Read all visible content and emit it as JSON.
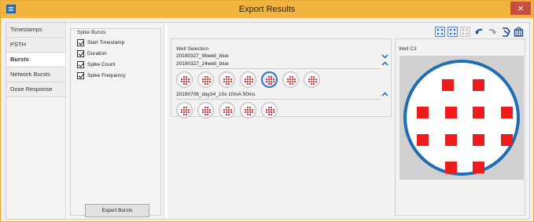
{
  "window": {
    "title": "Export Results",
    "close_glyph": "×",
    "accent_color": "#f1b53f",
    "icon": "app-grid-icon"
  },
  "nav": {
    "items": [
      {
        "label": "Timestamps",
        "active": false
      },
      {
        "label": "PSTH",
        "active": false
      },
      {
        "label": "Bursts",
        "active": true
      },
      {
        "label": "Network Bursts",
        "active": false
      },
      {
        "label": "Dose Response",
        "active": false
      }
    ]
  },
  "spike_bursts": {
    "group_title": "Spike Bursts",
    "options": [
      {
        "label": "Start Timestamp",
        "checked": true
      },
      {
        "label": "Duration",
        "checked": true
      },
      {
        "label": "Spike Count",
        "checked": true
      },
      {
        "label": "Spike Frequency",
        "checked": true
      }
    ],
    "export_button": "Export Bursts"
  },
  "toolbar": {
    "icons": [
      "grid-select-all-icon",
      "grid-select-some-icon",
      "grid-select-none-icon",
      "undo-icon",
      "redo-icon",
      "plate-load-icon",
      "plate-icon"
    ]
  },
  "well_selection": {
    "title": "Well Selection",
    "plates": [
      {
        "name": "20190327_96well_blue",
        "expanded": false
      },
      {
        "name": "20190327_24well_blue",
        "expanded": true,
        "wells": 7,
        "selected_index": 4
      },
      {
        "name": "20190708_day34_10x 10mA 50ms",
        "expanded": true,
        "wells": 5
      }
    ],
    "selected_color": "#2a72c4",
    "electrode_color": "#d43c3c"
  },
  "well_detail": {
    "title": "Well C3",
    "ring_color": "#1f6eb5",
    "electrode_color": "#ee1c1c",
    "electrode_count": 12
  }
}
